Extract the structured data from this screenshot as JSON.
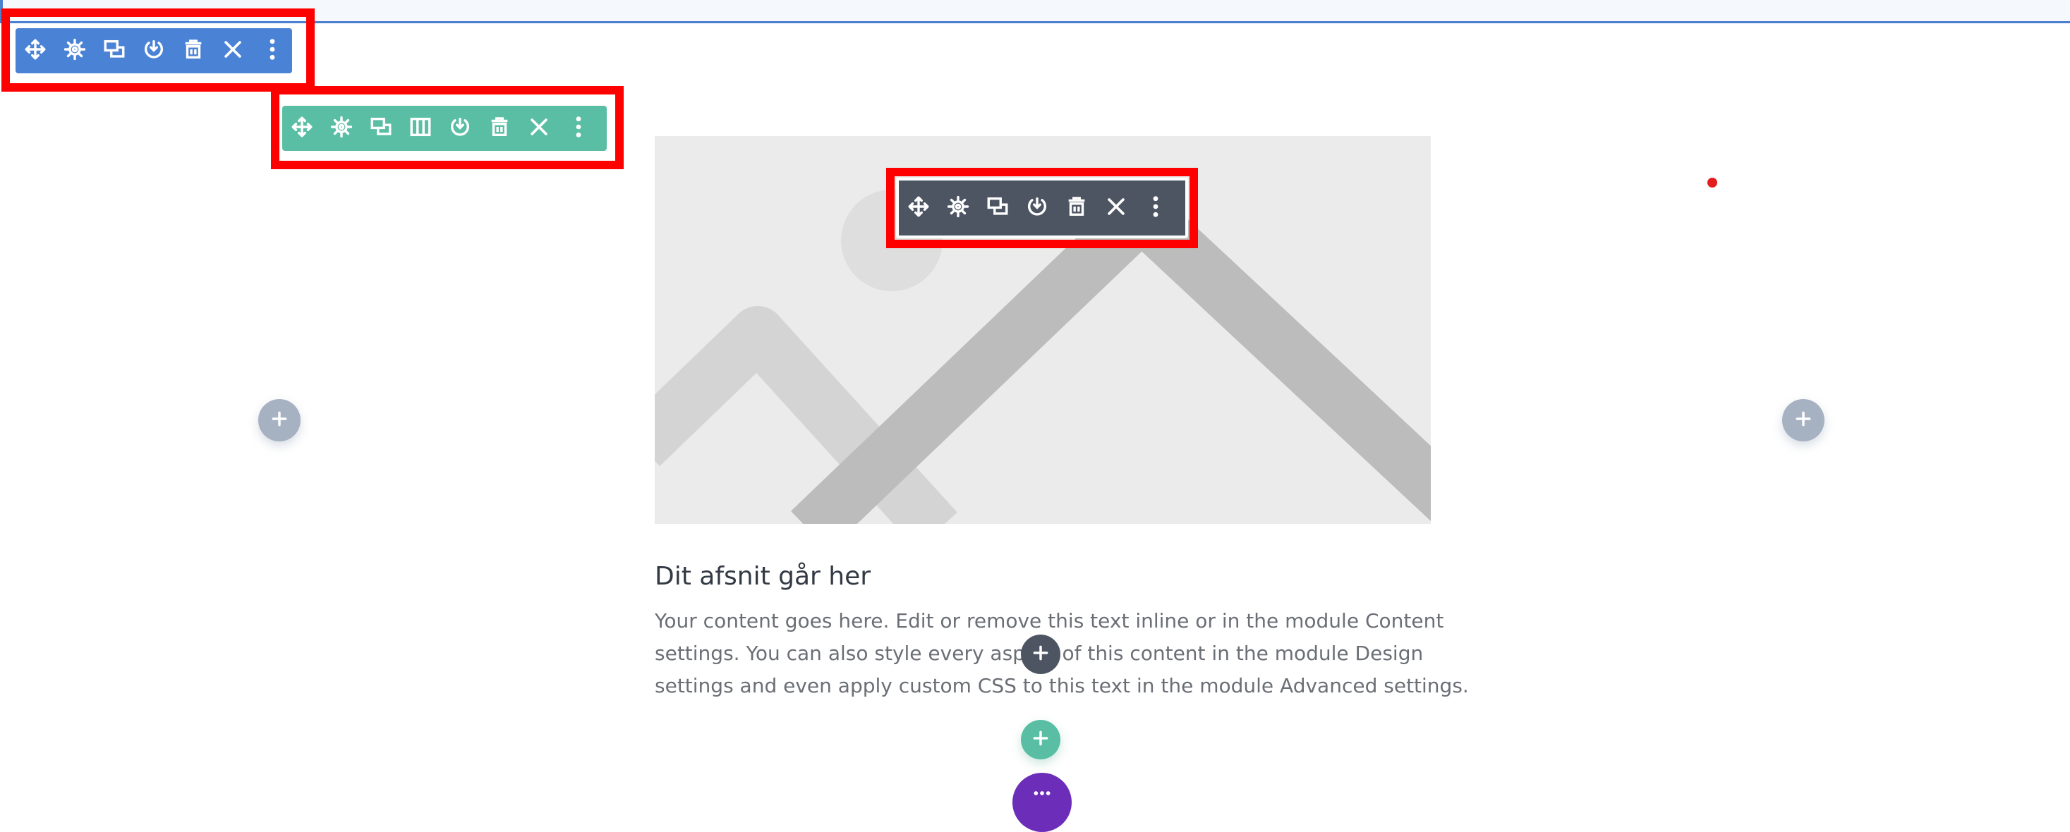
{
  "colors": {
    "section_toolbar": "#4a82d6",
    "row_toolbar": "#59bea4",
    "module_toolbar": "#4d5563",
    "highlight": "#ff0000",
    "add_column_button": "#a6b1c2",
    "add_row_button": "#59bea4",
    "page_settings_button": "#6c2eb9"
  },
  "section_toolbar": {
    "icons": [
      "move-icon",
      "gear-icon",
      "duplicate-icon",
      "save-icon",
      "trash-icon",
      "close-icon",
      "more-icon"
    ]
  },
  "row_toolbar": {
    "icons": [
      "move-icon",
      "gear-icon",
      "duplicate-icon",
      "columns-icon",
      "save-icon",
      "trash-icon",
      "close-icon",
      "more-icon"
    ]
  },
  "module_toolbar": {
    "icons": [
      "move-icon",
      "gear-icon",
      "duplicate-icon",
      "save-icon",
      "trash-icon",
      "close-icon",
      "more-icon"
    ]
  },
  "module": {
    "image_placeholder_icon": "image-placeholder-icon",
    "title": "Dit afsnit går her",
    "body_lines": [
      "Your content goes here. Edit or remove this text inline or in the module Content",
      "settings. You can also style every aspect of this content in the module Design",
      "settings and even apply custom CSS to this text in the module Advanced settings."
    ]
  },
  "buttons": {
    "add_column_left_icon": "plus-icon",
    "add_column_right_icon": "plus-icon",
    "add_module_icon": "plus-icon",
    "add_row_icon": "plus-icon",
    "page_settings_icon": "more-horizontal-icon"
  }
}
